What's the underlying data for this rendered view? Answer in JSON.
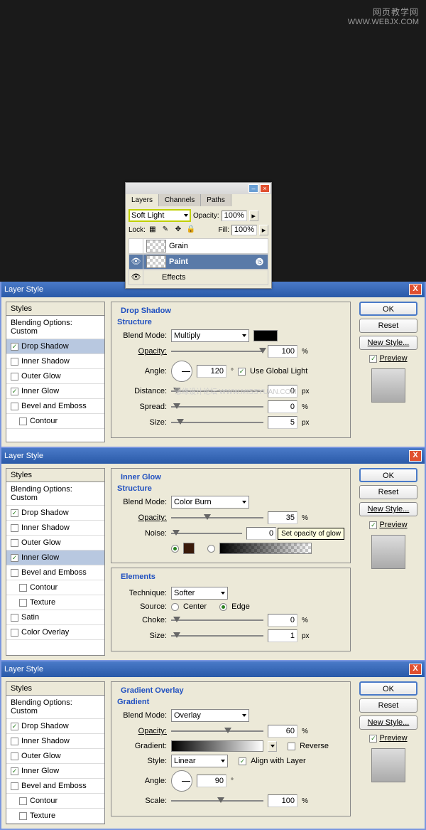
{
  "watermark": {
    "line1": "网页教学网",
    "line2": "WWW.WEBJX.COM"
  },
  "layers_panel": {
    "tabs": [
      "Layers",
      "Channels",
      "Paths"
    ],
    "blend_mode": "Soft Light",
    "opacity_label": "Opacity:",
    "opacity_value": "100%",
    "lock_label": "Lock:",
    "fill_label": "Fill:",
    "fill_value": "100%",
    "layers": [
      {
        "name": "Grain"
      },
      {
        "name": "Paint"
      }
    ],
    "effects_label": "Effects"
  },
  "dialogs": [
    {
      "title": "Layer Style",
      "left": {
        "header": "Styles",
        "blending": "Blending Options: Custom",
        "items": [
          {
            "label": "Drop Shadow",
            "checked": true,
            "selected": true
          },
          {
            "label": "Inner Shadow",
            "checked": false
          },
          {
            "label": "Outer Glow",
            "checked": false
          },
          {
            "label": "Inner Glow",
            "checked": true
          },
          {
            "label": "Bevel and Emboss",
            "checked": false
          },
          {
            "label": "Contour",
            "checked": false,
            "sub": true
          }
        ]
      },
      "section": {
        "title": "Drop Shadow",
        "sub": "Structure",
        "blend_mode_label": "Blend Mode:",
        "blend_mode": "Multiply",
        "opacity_label": "Opacity:",
        "opacity": "100",
        "angle_label": "Angle:",
        "angle": "120",
        "global_light": "Use Global Light",
        "distance_label": "Distance:",
        "distance": "0",
        "spread_label": "Spread:",
        "spread": "0",
        "size_label": "Size:",
        "size": "5"
      },
      "buttons": {
        "ok": "OK",
        "reset": "Reset",
        "new_style": "New Style...",
        "preview": "Preview"
      },
      "wm": "思缘设计论坛   WWW.MISSYUAN.COM"
    },
    {
      "title": "Layer Style",
      "left": {
        "header": "Styles",
        "blending": "Blending Options: Custom",
        "items": [
          {
            "label": "Drop Shadow",
            "checked": true
          },
          {
            "label": "Inner Shadow",
            "checked": false
          },
          {
            "label": "Outer Glow",
            "checked": false
          },
          {
            "label": "Inner Glow",
            "checked": true,
            "selected": true
          },
          {
            "label": "Bevel and Emboss",
            "checked": false
          },
          {
            "label": "Contour",
            "checked": false,
            "sub": true
          },
          {
            "label": "Texture",
            "checked": false,
            "sub": true
          },
          {
            "label": "Satin",
            "checked": false
          },
          {
            "label": "Color Overlay",
            "checked": false
          }
        ]
      },
      "section": {
        "title": "Inner Glow",
        "sub": "Structure",
        "blend_mode_label": "Blend Mode:",
        "blend_mode": "Color Burn",
        "opacity_label": "Opacity:",
        "opacity": "35",
        "noise_label": "Noise:",
        "noise": "0",
        "tooltip": "Set opacity of glow",
        "elements_title": "Elements",
        "technique_label": "Technique:",
        "technique": "Softer",
        "source_label": "Source:",
        "center": "Center",
        "edge": "Edge",
        "choke_label": "Choke:",
        "choke": "0",
        "size_label": "Size:",
        "size": "1"
      },
      "buttons": {
        "ok": "OK",
        "reset": "Reset",
        "new_style": "New Style...",
        "preview": "Preview"
      }
    },
    {
      "title": "Layer Style",
      "left": {
        "header": "Styles",
        "blending": "Blending Options: Custom",
        "items": [
          {
            "label": "Drop Shadow",
            "checked": true
          },
          {
            "label": "Inner Shadow",
            "checked": false
          },
          {
            "label": "Outer Glow",
            "checked": false
          },
          {
            "label": "Inner Glow",
            "checked": true
          },
          {
            "label": "Bevel and Emboss",
            "checked": false
          },
          {
            "label": "Contour",
            "checked": false,
            "sub": true
          },
          {
            "label": "Texture",
            "checked": false,
            "sub": true
          }
        ]
      },
      "section": {
        "title": "Gradient Overlay",
        "sub": "Gradient",
        "blend_mode_label": "Blend Mode:",
        "blend_mode": "Overlay",
        "opacity_label": "Opacity:",
        "opacity": "60",
        "gradient_label": "Gradient:",
        "reverse": "Reverse",
        "style_label": "Style:",
        "style": "Linear",
        "align": "Align with Layer",
        "angle_label": "Angle:",
        "angle": "90",
        "scale_label": "Scale:",
        "scale": "100"
      },
      "buttons": {
        "ok": "OK",
        "reset": "Reset",
        "new_style": "New Style...",
        "preview": "Preview"
      }
    }
  ],
  "units": {
    "percent": "%",
    "px": "px",
    "deg": "°"
  }
}
